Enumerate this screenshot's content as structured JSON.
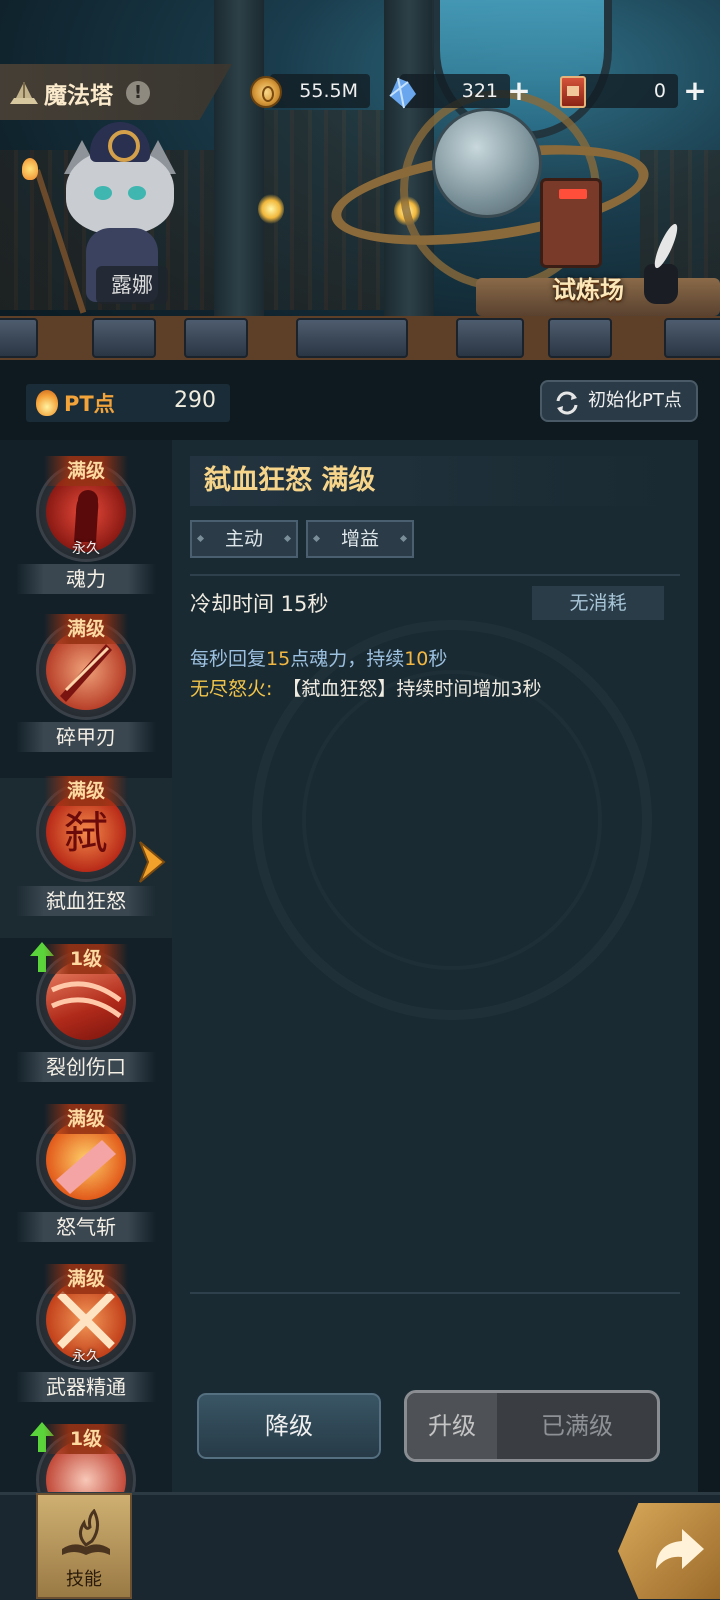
{
  "scene": {
    "character_name": "露娜",
    "trial_label": "试炼场"
  },
  "topbar": {
    "title": "魔法塔",
    "warn": "!",
    "currencies": [
      {
        "icon": "gold-coin-icon",
        "value": "55.5M"
      },
      {
        "icon": "crystal-icon",
        "value": "321"
      },
      {
        "icon": "ticket-card-icon",
        "value": "0"
      }
    ],
    "plus": "+"
  },
  "pt": {
    "label": "PT点",
    "value": "290",
    "reset_label": "初始化PT点"
  },
  "skills": [
    {
      "level": "满级",
      "name": "魂力",
      "permanent": "永久",
      "upgradable": false
    },
    {
      "level": "满级",
      "name": "碎甲刃",
      "permanent": "",
      "upgradable": false
    },
    {
      "level": "满级",
      "name": "弑血狂怒",
      "permanent": "",
      "upgradable": false
    },
    {
      "level": "1级",
      "name": "裂创伤口",
      "permanent": "",
      "upgradable": true
    },
    {
      "level": "满级",
      "name": "怒气斩",
      "permanent": "",
      "upgradable": false
    },
    {
      "level": "满级",
      "name": "武器精通",
      "permanent": "永久",
      "upgradable": false
    },
    {
      "level": "1级",
      "name": "",
      "permanent": "",
      "upgradable": true
    }
  ],
  "selected_skill_index": 2,
  "detail": {
    "title": "弑血狂怒 满级",
    "tags": [
      "主动",
      "增益"
    ],
    "cooldown": "冷却时间 15秒",
    "cost": "无消耗",
    "desc_parts": [
      "每秒回复",
      "15",
      "点魂力，持续",
      "10",
      "秒"
    ],
    "passive_key": "无尽怒火:",
    "passive_value": "【弑血狂怒】持续时间增加3秒",
    "downgrade_label": "降级",
    "upgrade_label": "升级",
    "maxed_label": "已满级"
  },
  "bottom": {
    "skill_tab_label": "技能"
  },
  "colors": {
    "accent_gold": "#f6d48a",
    "highlight_orange": "#f2b742",
    "desc_blue": "#9cc0e0"
  }
}
